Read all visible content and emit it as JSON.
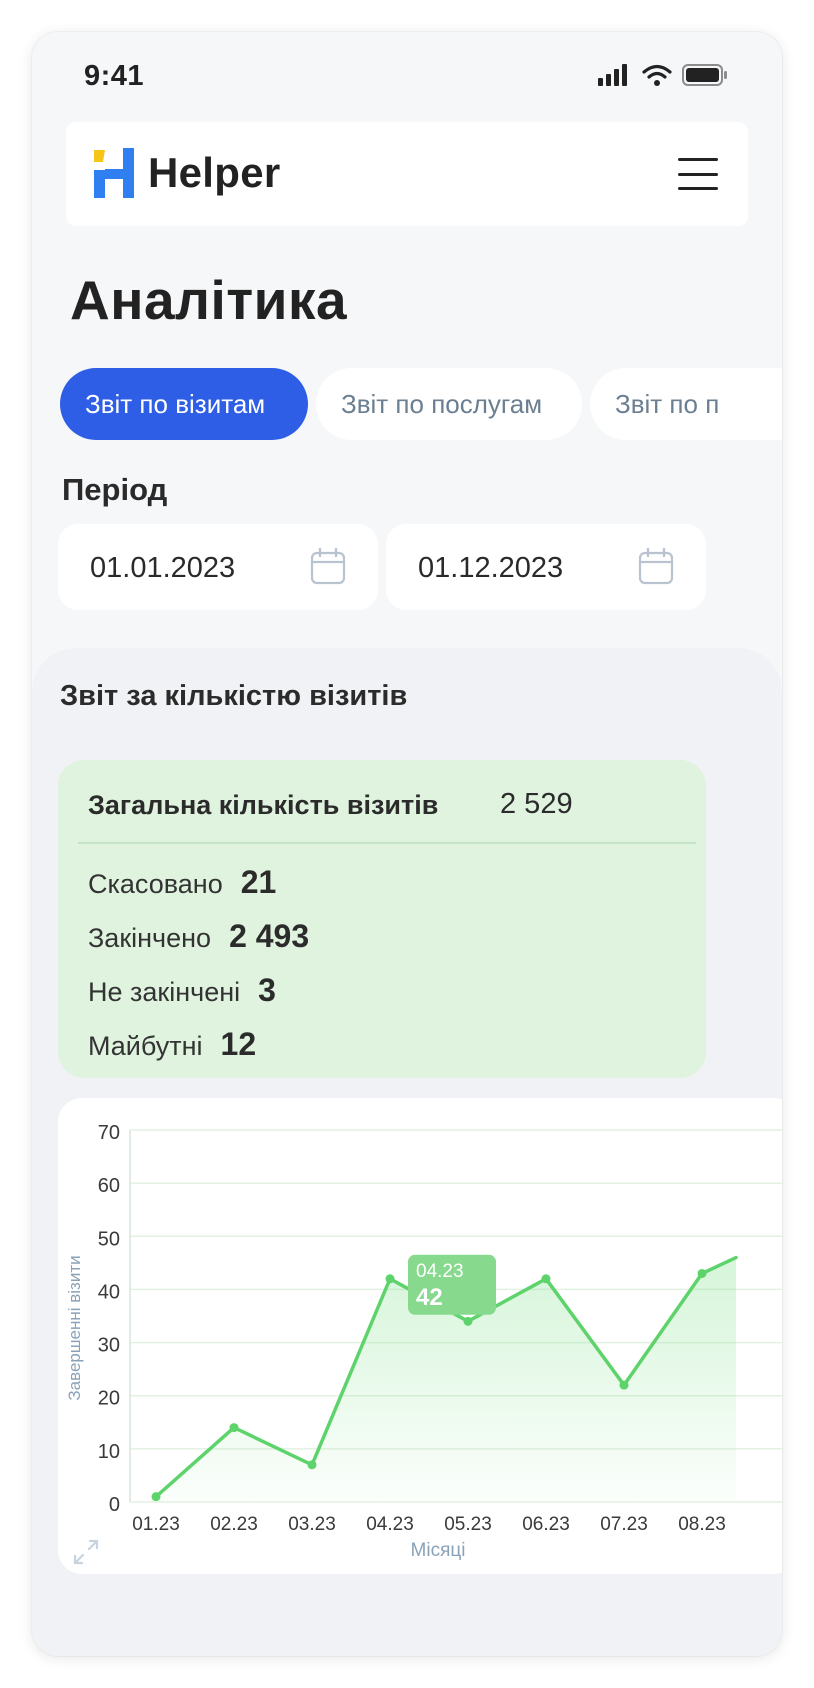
{
  "status_bar": {
    "time": "9:41"
  },
  "header": {
    "brand": "Helper"
  },
  "page": {
    "title": "Аналітика"
  },
  "tabs": [
    {
      "label": "Звіт по візитам",
      "active": true
    },
    {
      "label": "Звіт по послугам",
      "active": false
    },
    {
      "label": "Звіт по п",
      "active": false
    }
  ],
  "period": {
    "label": "Період",
    "from": "01.01.2023",
    "to": "01.12.2023"
  },
  "report": {
    "title": "Звіт за кількістю візитів",
    "total_label": "Загальна кількість візитів",
    "total_value": "2 529",
    "stats": [
      {
        "label": "Скасовано",
        "value": "21"
      },
      {
        "label": "Закінчено",
        "value": "2 493"
      },
      {
        "label": "Не закінчені",
        "value": "3"
      },
      {
        "label": "Майбутні",
        "value": "12"
      }
    ]
  },
  "colors": {
    "accent": "#2f5ee6",
    "chart_line": "#5fd36b",
    "stats_bg": "#dff3df",
    "tooltip_bg": "#86d98d"
  },
  "chart_data": {
    "type": "line",
    "categories": [
      "01.23",
      "02.23",
      "03.23",
      "04.23",
      "05.23",
      "06.23",
      "07.23",
      "08.23"
    ],
    "series": [
      {
        "values": [
          1,
          14,
          7,
          42,
          34,
          42,
          22,
          43
        ]
      }
    ],
    "trailing_point_partial": 46,
    "ylim": [
      0,
      70
    ],
    "yticks": [
      0,
      10,
      20,
      30,
      40,
      50,
      60,
      70
    ],
    "xlabel": "Місяці",
    "ylabel": "Завершенні візити",
    "grid": true,
    "tooltip": {
      "category": "04.23",
      "value": "42"
    }
  }
}
